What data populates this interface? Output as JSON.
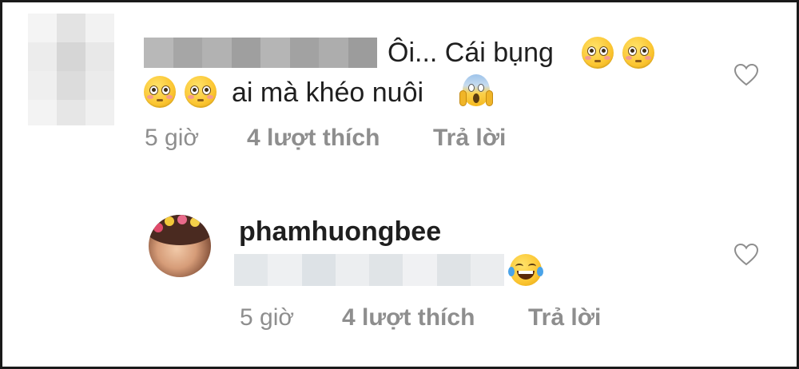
{
  "comment1": {
    "text_line1": "Ôi... Cái bụng",
    "text_line2": "ai mà khéo nuôi",
    "time": "5 giờ",
    "likes": "4 lượt thích",
    "reply": "Trả lời",
    "emojis": [
      "flushed-face-icon",
      "flushed-face-icon",
      "flushed-face-icon",
      "flushed-face-icon",
      "screaming-face-icon"
    ]
  },
  "reply1": {
    "username": "phamhuongbee",
    "time": "5 giờ",
    "likes": "4 lượt thích",
    "reply": "Trả lời",
    "emojis": [
      "face-with-tears-of-joy-icon"
    ]
  },
  "colors": {
    "text": "#1f1f1f",
    "meta": "#8e8e8e",
    "border": "#1a1a1a",
    "blur_light": "#e9ecef",
    "blur_dark": "#a8a8a8"
  },
  "icons": {
    "like": "heart-outline-icon"
  }
}
